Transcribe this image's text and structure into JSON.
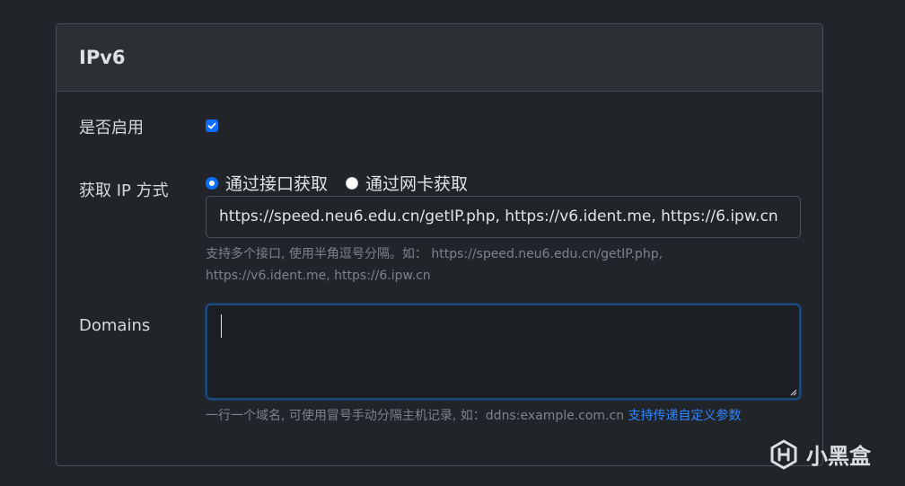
{
  "card": {
    "title": "IPv6"
  },
  "enable": {
    "label": "是否启用",
    "checked": true
  },
  "get_ip": {
    "label": "获取 IP 方式",
    "options": [
      {
        "label": "通过接口获取",
        "selected": true
      },
      {
        "label": "通过网卡获取",
        "selected": false
      }
    ],
    "urls_value": "https://speed.neu6.edu.cn/getIP.php, https://v6.ident.me, https://6.ipw.cn",
    "help_line1": "支持多个接口, 使用半角逗号分隔。如： https://speed.neu6.edu.cn/getIP.php,",
    "help_line2": "https://v6.ident.me, https://6.ipw.cn"
  },
  "domains": {
    "label": "Domains",
    "value": "",
    "help_text": "一行一个域名, 可使用冒号手动分隔主机记录, 如：ddns:example.com.cn ",
    "help_link": "支持传递自定义参数"
  },
  "watermark": {
    "text": "小黑盒",
    "icon": "xiaoheihe-logo-icon"
  },
  "colors": {
    "background": "#212529",
    "header": "#2b3035",
    "accent": "#0d6efd",
    "link": "#2f86ff"
  }
}
